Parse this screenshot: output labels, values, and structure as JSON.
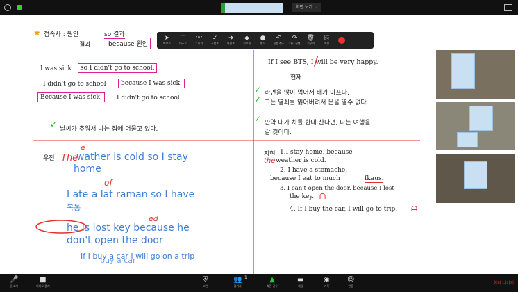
{
  "topbar": {
    "share_label": "화면 보기 ⌄"
  },
  "board": {
    "star_label": "접속사 : 원인",
    "result_label": "결과",
    "so_result": "so 결과",
    "because_cause": "because 원인",
    "left_sentences": [
      "I was sick",
      "so I didn't go to school.",
      "I didn't go to school",
      "because I was sick.",
      "Because I was sick,",
      "I didn't go to school."
    ],
    "weather_sentence": "날씨가 추워서 나는 집에 머물고 있다.",
    "example_label": "우전",
    "blue_lines": [
      "wather is cold so I stay",
      "home",
      "I ate a lat raman  so I have",
      "복통",
      "he is lost key because he",
      "don't open the door",
      "If I  buy a car I will go on a trip"
    ],
    "blue_overlay": "buy a car",
    "red_notes": {
      "the_top": "The",
      "e_mark": "e",
      "of_mark": "of",
      "ed_mark": "ed",
      "the_right": "the",
      "bts_slash": "/"
    },
    "right_top": {
      "if_sentence": "If I see BTS, I will be very happy.",
      "present": "현재",
      "korean_1": "라면을 많이 먹어서 배가 아프다.",
      "korean_2": "그는 열쇠를 잃어버려서 문을 열수 없다.",
      "korean_3a": "만약 내가 차를 한대 산다면, 나는 여행을",
      "korean_3b": "갈 것이다."
    },
    "right_bottom": {
      "name": "지현",
      "line1": "1.I stay home, because",
      "line1b": "weather is cold.",
      "line2": "2. I have a stomache,",
      "line2b": "because I eat to much",
      "line2c": "fkaus.",
      "line3": "3. I   can't open the door, because I lost",
      "line3b": "the key.",
      "line4": "4. If I buy the car, I will go to trip."
    }
  },
  "annotation_toolbar": {
    "tools": [
      {
        "icon": "mouse-icon",
        "glyph": "➤",
        "label": "마우스"
      },
      {
        "icon": "text-icon",
        "glyph": "T",
        "label": "텍스트"
      },
      {
        "icon": "draw-icon",
        "glyph": "〰",
        "label": "그리기"
      },
      {
        "icon": "stamp-icon",
        "glyph": "✓",
        "label": "스탬프"
      },
      {
        "icon": "spotlight-icon",
        "glyph": "➜",
        "label": "화살표"
      },
      {
        "icon": "eraser-icon",
        "glyph": "◆",
        "label": "지우개"
      },
      {
        "icon": "format-icon",
        "glyph": "●",
        "label": "형식"
      },
      {
        "icon": "undo-icon",
        "glyph": "↶",
        "label": "실행 취소"
      },
      {
        "icon": "redo-icon",
        "glyph": "↷",
        "label": "다시 실행"
      },
      {
        "icon": "clear-icon",
        "glyph": "🗑",
        "label": "지우기"
      },
      {
        "icon": "save-icon",
        "glyph": "⎘",
        "label": "저장"
      }
    ],
    "active_index": 1
  },
  "bottombar": {
    "items": [
      {
        "icon": "mute-icon",
        "glyph": "🎤",
        "label": "음소거"
      },
      {
        "icon": "video-icon",
        "glyph": "■",
        "label": "비디오 중지"
      },
      {
        "icon": "security-icon",
        "glyph": "⛨",
        "label": "보안"
      },
      {
        "icon": "participants-icon",
        "glyph": "👥",
        "label": "참가자"
      },
      {
        "icon": "share-screen-icon",
        "glyph": "▲",
        "label": "화면 공유"
      },
      {
        "icon": "chat-icon",
        "glyph": "▬",
        "label": "채팅"
      },
      {
        "icon": "record-icon",
        "glyph": "◉",
        "label": "기록"
      },
      {
        "icon": "reactions-icon",
        "glyph": "☺",
        "label": "반응"
      }
    ],
    "participants_count": "1",
    "end_label": "회의 나가기"
  },
  "colors": {
    "pink_box": "#e0208f",
    "blue_ink": "#3f7fd8",
    "red_ink": "#e23030",
    "check_green": "#25b825"
  }
}
